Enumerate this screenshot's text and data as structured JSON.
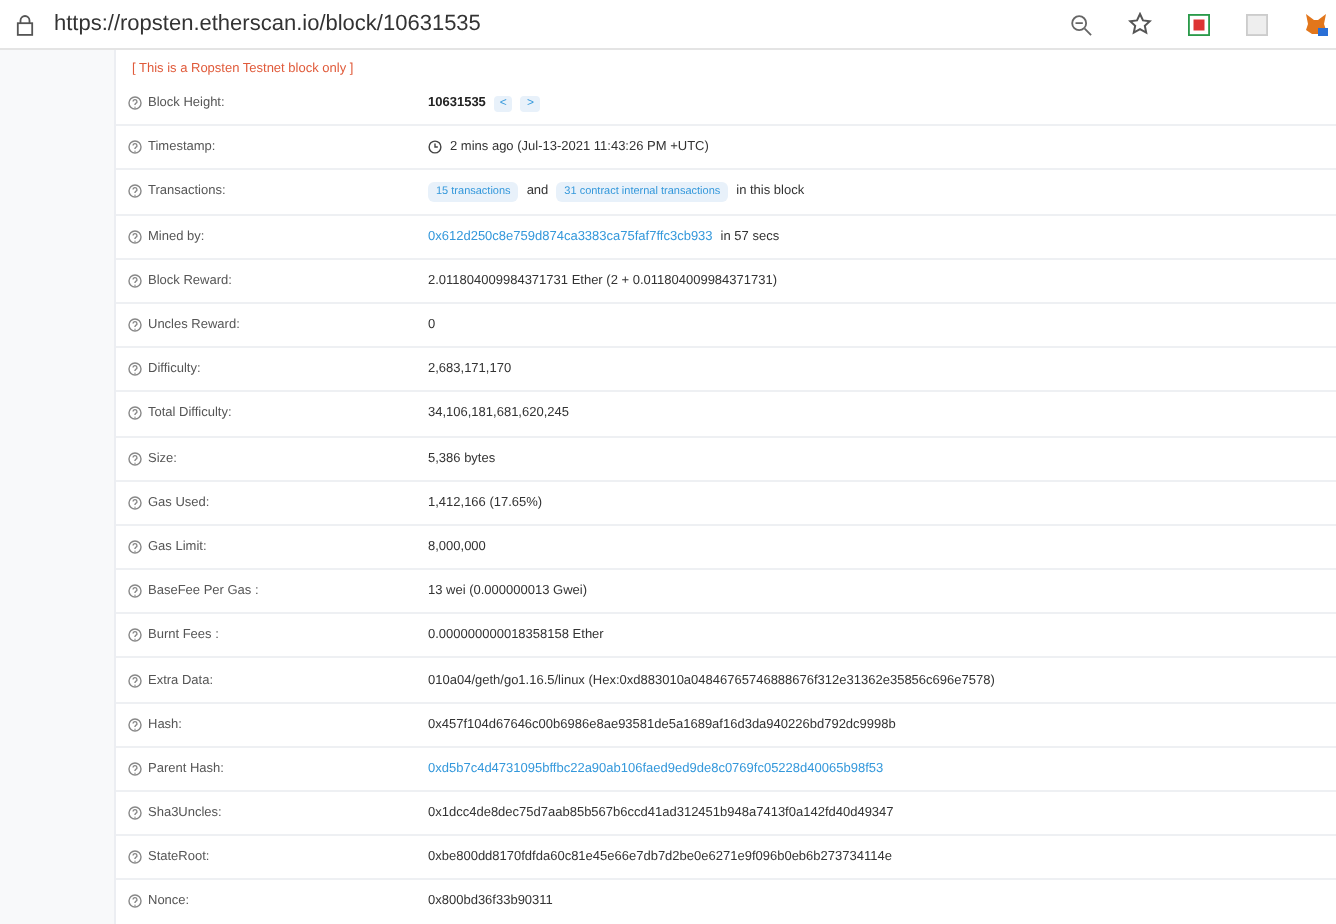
{
  "address_bar": {
    "url": "https://ropsten.etherscan.io/block/10631535"
  },
  "notice": "[ This is a Ropsten Testnet block only ]",
  "rows": [
    {
      "label": "Block Height:",
      "value": [
        {
          "kind": "strong",
          "text": "10631535"
        },
        {
          "kind": "nav",
          "text": "<"
        },
        {
          "kind": "nav",
          "text": ">"
        }
      ]
    },
    {
      "label": "Timestamp:",
      "value": [
        {
          "kind": "clock",
          "text": "2 mins ago (Jul-13-2021 11:43:26 PM +UTC)"
        }
      ]
    },
    {
      "label": "Transactions:",
      "value": [
        {
          "kind": "badge",
          "text": "15 transactions"
        },
        {
          "kind": "text",
          "text": "and"
        },
        {
          "kind": "badge",
          "text": "31 contract internal transactions"
        },
        {
          "kind": "text",
          "text": "in this block"
        }
      ]
    },
    {
      "label": "Mined by:",
      "value": [
        {
          "kind": "link",
          "text": "0x612d250c8e759d874ca3383ca75faf7ffc3cb933"
        },
        {
          "kind": "text",
          "text": "in 57 secs"
        }
      ]
    },
    {
      "label": "Block Reward:",
      "value": [
        {
          "kind": "text",
          "text": "2.011804009984371731 Ether (2 + 0.011804009984371731)"
        }
      ]
    },
    {
      "label": "Uncles Reward:",
      "value": [
        {
          "kind": "text",
          "text": "0"
        }
      ]
    },
    {
      "label": "Difficulty:",
      "value": [
        {
          "kind": "text",
          "text": "2,683,171,170"
        }
      ]
    },
    {
      "label": "Total Difficulty:",
      "value": [
        {
          "kind": "text",
          "text": "34,106,181,681,620,245"
        }
      ]
    },
    {
      "label": "Size:",
      "value": [
        {
          "kind": "text",
          "text": "5,386 bytes"
        }
      ]
    },
    {
      "label": "Gas Used:",
      "value": [
        {
          "kind": "text",
          "text": "1,412,166 (17.65%)"
        }
      ]
    },
    {
      "label": "Gas Limit:",
      "value": [
        {
          "kind": "text",
          "text": "8,000,000"
        }
      ]
    },
    {
      "label": "BaseFee Per Gas :",
      "value": [
        {
          "kind": "text",
          "text": "13 wei (0.000000013 Gwei)"
        }
      ]
    },
    {
      "label": "Burnt Fees :",
      "value": [
        {
          "kind": "text",
          "text": "0.000000000018358158 Ether"
        }
      ]
    },
    {
      "label": "Extra Data:",
      "value": [
        {
          "kind": "text",
          "text": "010a04/geth/go1.16.5/linux (Hex:0xd883010a04846765746888676f312e31362e35856c696e7578)"
        }
      ]
    },
    {
      "label": "Hash:",
      "value": [
        {
          "kind": "text",
          "text": "0x457f104d67646c00b6986e8ae93581de5a1689af16d3da940226bd792dc9998b"
        }
      ]
    },
    {
      "label": "Parent Hash:",
      "value": [
        {
          "kind": "link",
          "text": "0xd5b7c4d4731095bffbc22a90ab106faed9ed9de8c0769fc05228d40065b98f53"
        }
      ]
    },
    {
      "label": "Sha3Uncles:",
      "value": [
        {
          "kind": "text",
          "text": "0x1dcc4de8dec75d7aab85b567b6ccd41ad312451b948a7413f0a142fd40d49347"
        }
      ]
    },
    {
      "label": "StateRoot:",
      "value": [
        {
          "kind": "text",
          "text": "0xbe800dd8170fdfda60c81e45e66e7db7d2be0e6271e9f096b0eb6b273734114e"
        }
      ]
    },
    {
      "label": "Nonce:",
      "value": [
        {
          "kind": "text",
          "text": "0x800bd36f33b90311"
        }
      ]
    }
  ]
}
